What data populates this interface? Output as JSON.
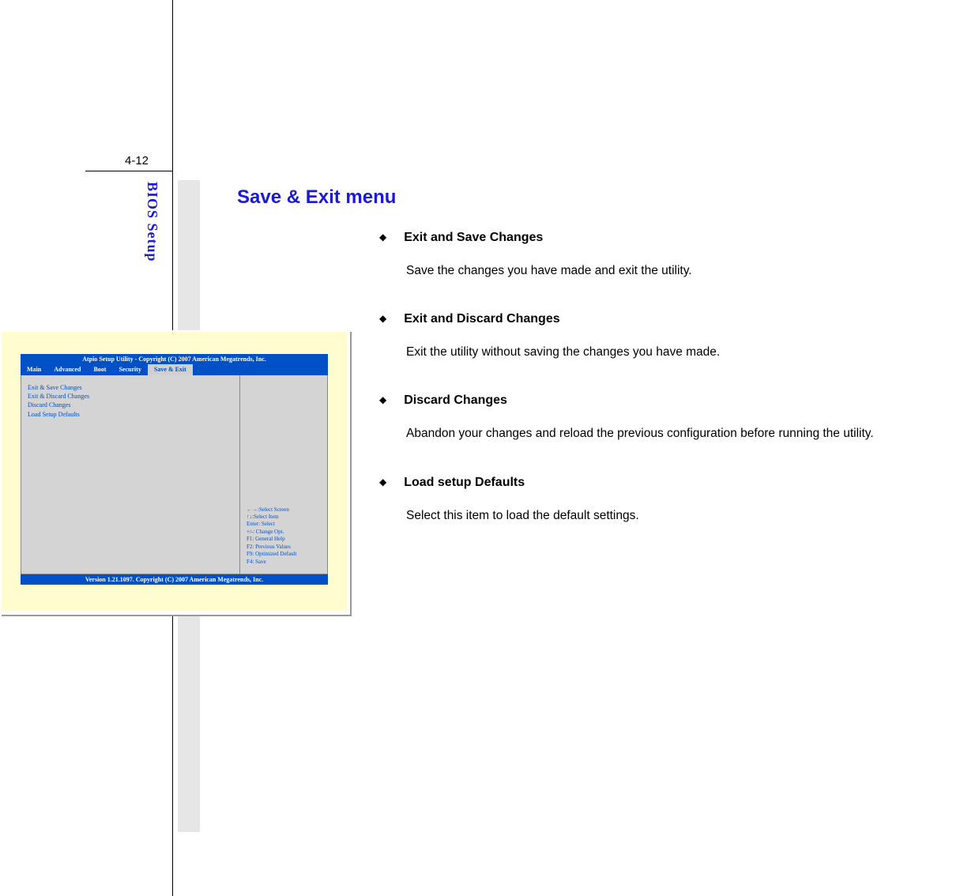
{
  "page_number": "4-12",
  "side_label": "BIOS Setup",
  "doc": {
    "title": "Save & Exit menu",
    "items": [
      {
        "title": "Exit and Save Changes",
        "body": "Save the changes you have made and exit the utility."
      },
      {
        "title": "Exit and Discard Changes",
        "body": "Exit the utility without saving the changes you have made."
      },
      {
        "title": "Discard Changes",
        "body": "Abandon your changes and reload the previous configuration before running the utility."
      },
      {
        "title": "Load setup Defaults",
        "body": "Select this item to load the default settings."
      }
    ]
  },
  "bios": {
    "title": "Atpio Setup Utility - Copyright (C) 2007 American Megatrends, Inc.",
    "tabs": [
      "Main",
      "Advanced",
      "Boot",
      "Security",
      "Save & Exit"
    ],
    "active_tab": "Save & Exit",
    "menu": [
      "Exit & Save Changes",
      "Exit & Discard Changes",
      "Discard Changes",
      "Load Setup Defaults"
    ],
    "help": [
      "←→:Select Screen",
      "↑↓:Select Item",
      "Enter: Select",
      "+/-: Change Opt.",
      "F1: General Help",
      "F2: Previous Values",
      "F9: Optimized Default",
      "F4: Save"
    ],
    "footer": "Version 1.21.1097. Copyright (C) 2007 American Megatrends, Inc."
  }
}
